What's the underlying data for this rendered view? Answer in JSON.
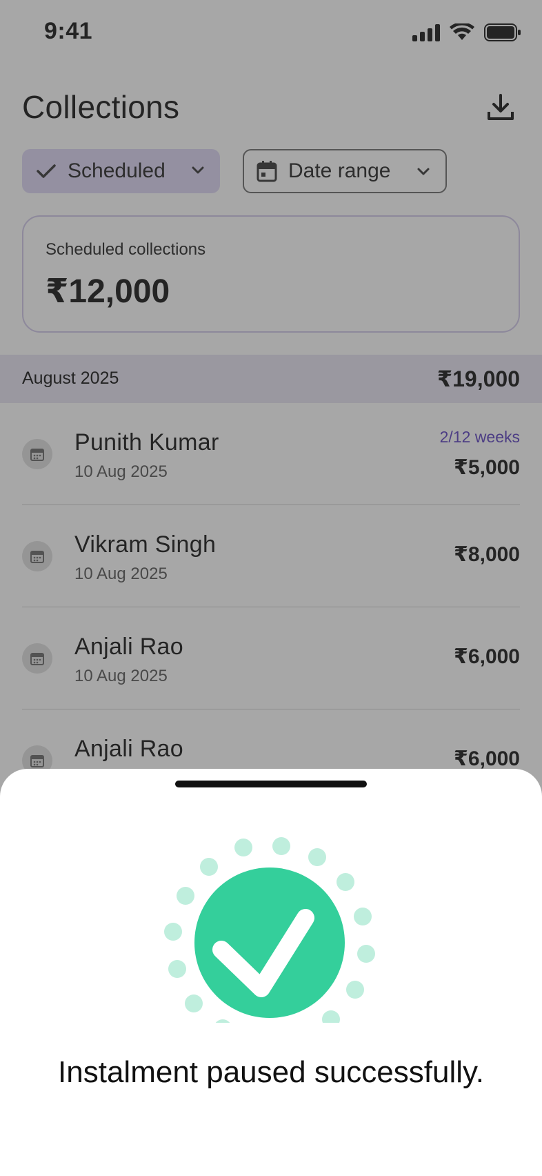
{
  "status_bar": {
    "time": "9:41"
  },
  "header": {
    "title": "Collections"
  },
  "filters": {
    "status_chip": "Scheduled",
    "date_chip": "Date range"
  },
  "summary": {
    "label": "Scheduled collections",
    "amount": "₹12,000"
  },
  "month_group": {
    "label": "August 2025",
    "total": "₹19,000"
  },
  "collections": [
    {
      "name": "Punith Kumar",
      "date": "10 Aug 2025",
      "amount": "₹5,000",
      "progress": "2/12 weeks"
    },
    {
      "name": "Vikram Singh",
      "date": "10 Aug 2025",
      "amount": "₹8,000"
    },
    {
      "name": "Anjali Rao",
      "date": "10 Aug 2025",
      "amount": "₹6,000"
    },
    {
      "name": "Anjali Rao",
      "amount": "₹6,000"
    }
  ],
  "sheet": {
    "message": "Instalment paused successfully."
  },
  "colors": {
    "accent": "#5a3fc0",
    "success": "#34cf9b",
    "chip_bg": "#ddd6f5",
    "band_bg": "#e8e4f3"
  },
  "icons": [
    "download-icon",
    "check-icon",
    "chevron-down-icon",
    "calendar-icon",
    "success-check-icon"
  ]
}
